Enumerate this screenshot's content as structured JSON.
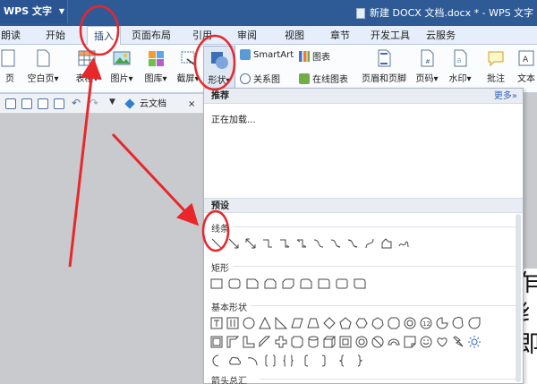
{
  "title_bar": {
    "app_menu_label": "WPS 文字",
    "document_title": "新建 DOCX 文档.docx * - WPS 文字"
  },
  "tabs": [
    "朗读",
    "开始",
    "插入",
    "页面布局",
    "引用",
    "审阅",
    "视图",
    "章节",
    "开发工具",
    "云服务"
  ],
  "active_tab": "插入",
  "ribbon": {
    "page_btn": "页",
    "blank_page": "空白页",
    "table": "表格",
    "picture": "图片",
    "gallery": "图库",
    "screenshot": "截屏",
    "shapes": "形状",
    "smartart": "SmartArt",
    "chart": "图表",
    "relation_chart": "关系图",
    "online_chart": "在线图表",
    "header_footer": "页眉和页脚",
    "page_number": "页码",
    "watermark": "水印",
    "comment": "批注",
    "text_box": "文本"
  },
  "quick_bar": {
    "cloud_doc_tab": "云文档",
    "close_glyph": "×"
  },
  "shapes_panel": {
    "recommended_header": "推荐",
    "more_link": "更多»",
    "loading_text": "正在加载...",
    "preset_header": "预设",
    "groups": {
      "lines": "线条",
      "rectangles": "矩形",
      "basic": "基本形状",
      "arrows": "箭头总汇"
    }
  },
  "document_text": [
    "乍",
    "纟",
    "即"
  ],
  "colors": {
    "title_bar": "#2e5b96",
    "annotation_red": "#e8272b"
  }
}
